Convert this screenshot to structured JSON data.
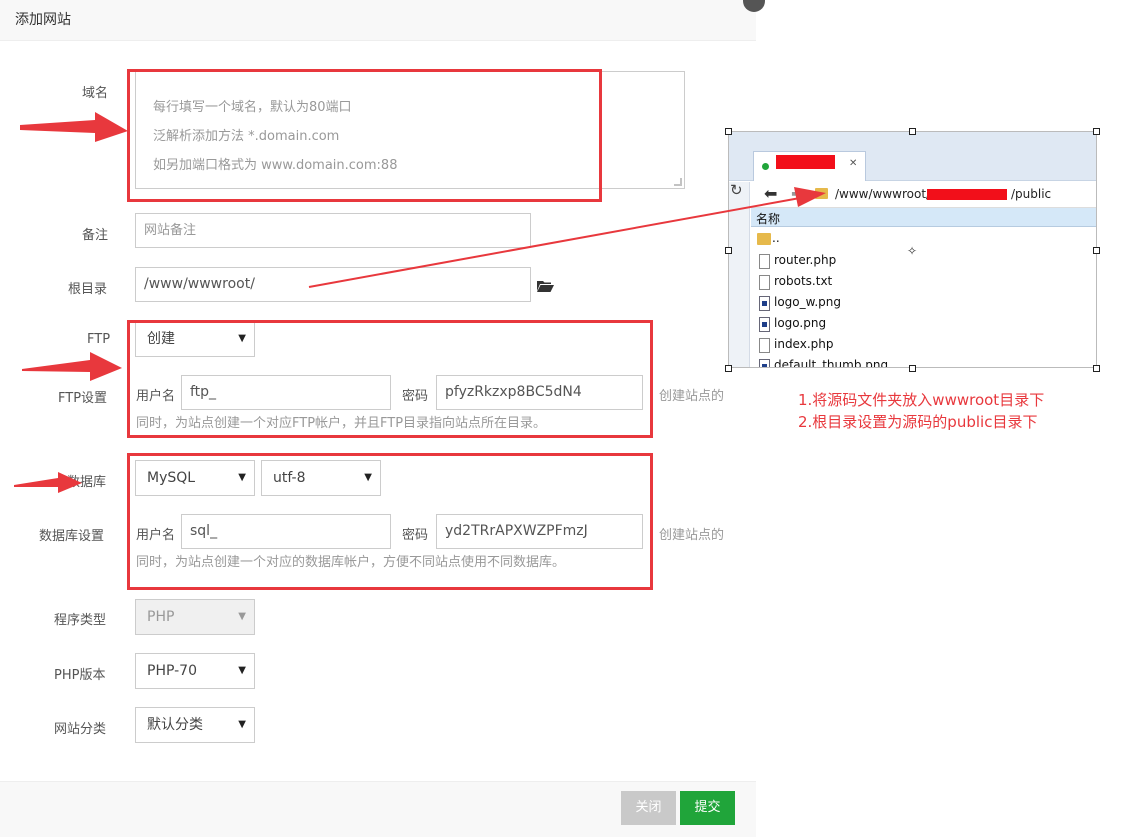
{
  "dialog": {
    "title": "添加网站",
    "domain": {
      "label": "域名",
      "placeholder_lines": [
        "每行填写一个域名，默认为80端口",
        "泛解析添加方法 *.domain.com",
        "如另加端口格式为 www.domain.com:88"
      ]
    },
    "remark": {
      "label": "备注",
      "placeholder": "网站备注"
    },
    "root": {
      "label": "根目录",
      "value": "/www/wwwroot/"
    },
    "ftp": {
      "label": "FTP",
      "select": "创建",
      "settings_label": "FTP设置",
      "user_label": "用户名",
      "user_value": "ftp_",
      "pass_label": "密码",
      "pass_value": "pfyzRkzxp8BC5dN4",
      "side_hint": "创建站点的",
      "hint": "同时，为站点创建一个对应FTP帐户，并且FTP目录指向站点所在目录。"
    },
    "database": {
      "label": "数据库",
      "type": "MySQL",
      "charset": "utf-8",
      "settings_label": "数据库设置",
      "user_label": "用户名",
      "user_value": "sql_",
      "pass_label": "密码",
      "pass_value": "yd2TRrAPXWZPFmzJ",
      "side_hint": "创建站点的",
      "hint": "同时，为站点创建一个对应的数据库帐户，方便不同站点使用不同数据库。"
    },
    "program_type": {
      "label": "程序类型",
      "value": "PHP"
    },
    "php_version": {
      "label": "PHP版本",
      "value": "PHP-70"
    },
    "category": {
      "label": "网站分类",
      "value": "默认分类"
    },
    "buttons": {
      "close": "关闭",
      "submit": "提交"
    }
  },
  "file_manager": {
    "path_prefix": "/www/wwwroot/",
    "path_suffix": "/public",
    "column_header": "名称",
    "files": [
      "..",
      "router.php",
      "robots.txt",
      "logo_w.png",
      "logo.png",
      "index.php",
      "default_thumb.png"
    ]
  },
  "notes": [
    "1.将源码文件夹放入wwwroot目录下",
    "2.根目录设置为源码的public目录下"
  ],
  "colors": {
    "highlight_red": "#e8383d",
    "submit_green": "#20a53a",
    "tab_status_green": "#20a53a"
  }
}
